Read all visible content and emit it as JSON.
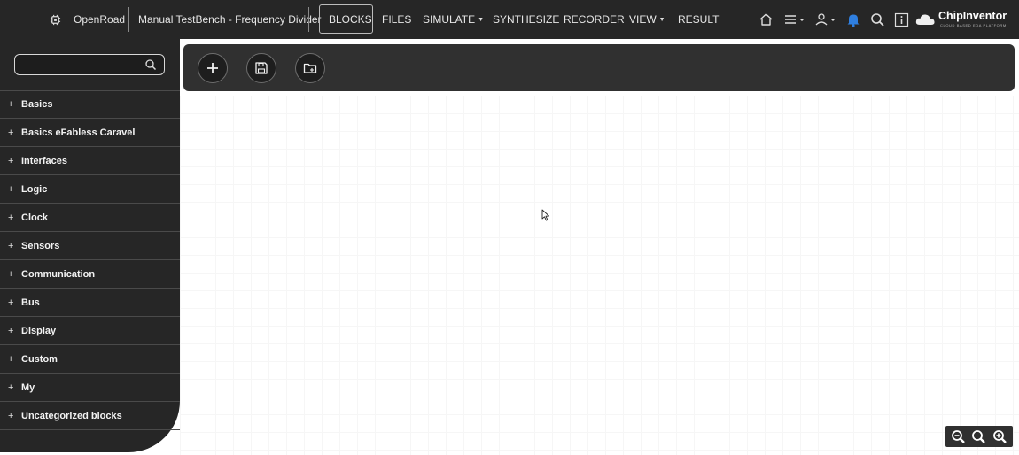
{
  "app": {
    "name": "OpenRoad",
    "project_title": "Manual TestBench - Frequency Divider",
    "brand": "ChipInventor",
    "brand_tagline": "CLOUD BASED EDA PLATFORM"
  },
  "nav": {
    "blocks": "BLOCKS",
    "files": "FILES",
    "simulate": "SIMULATE",
    "synthesize": "SYNTHESIZE",
    "recorder": "RECORDER",
    "view": "VIEW",
    "result": "RESULT"
  },
  "colors": {
    "topbar_bg": "#262626",
    "sidebar_bg": "#262626",
    "toolbar_bg": "#303030",
    "bell": "#2f7fe0"
  },
  "icons": {
    "chip": "chip-icon",
    "home": "home-icon",
    "menu": "hamburger-menu-icon",
    "user": "user-icon",
    "bell": "bell-icon",
    "search": "search-icon",
    "info": "info-icon",
    "cloud": "cloud-logo-icon",
    "add": "plus-icon",
    "save": "floppy-disk-icon",
    "open": "folder-open-icon",
    "zoom_out": "zoom-out-icon",
    "zoom_reset": "zoom-reset-icon",
    "zoom_in": "zoom-in-icon"
  },
  "sidebar": {
    "search_placeholder": "",
    "categories": [
      "Basics",
      "Basics eFabless Caravel",
      "Interfaces",
      "Logic",
      "Clock",
      "Sensors",
      "Communication",
      "Bus",
      "Display",
      "Custom",
      "My",
      "Uncategorized blocks"
    ]
  }
}
